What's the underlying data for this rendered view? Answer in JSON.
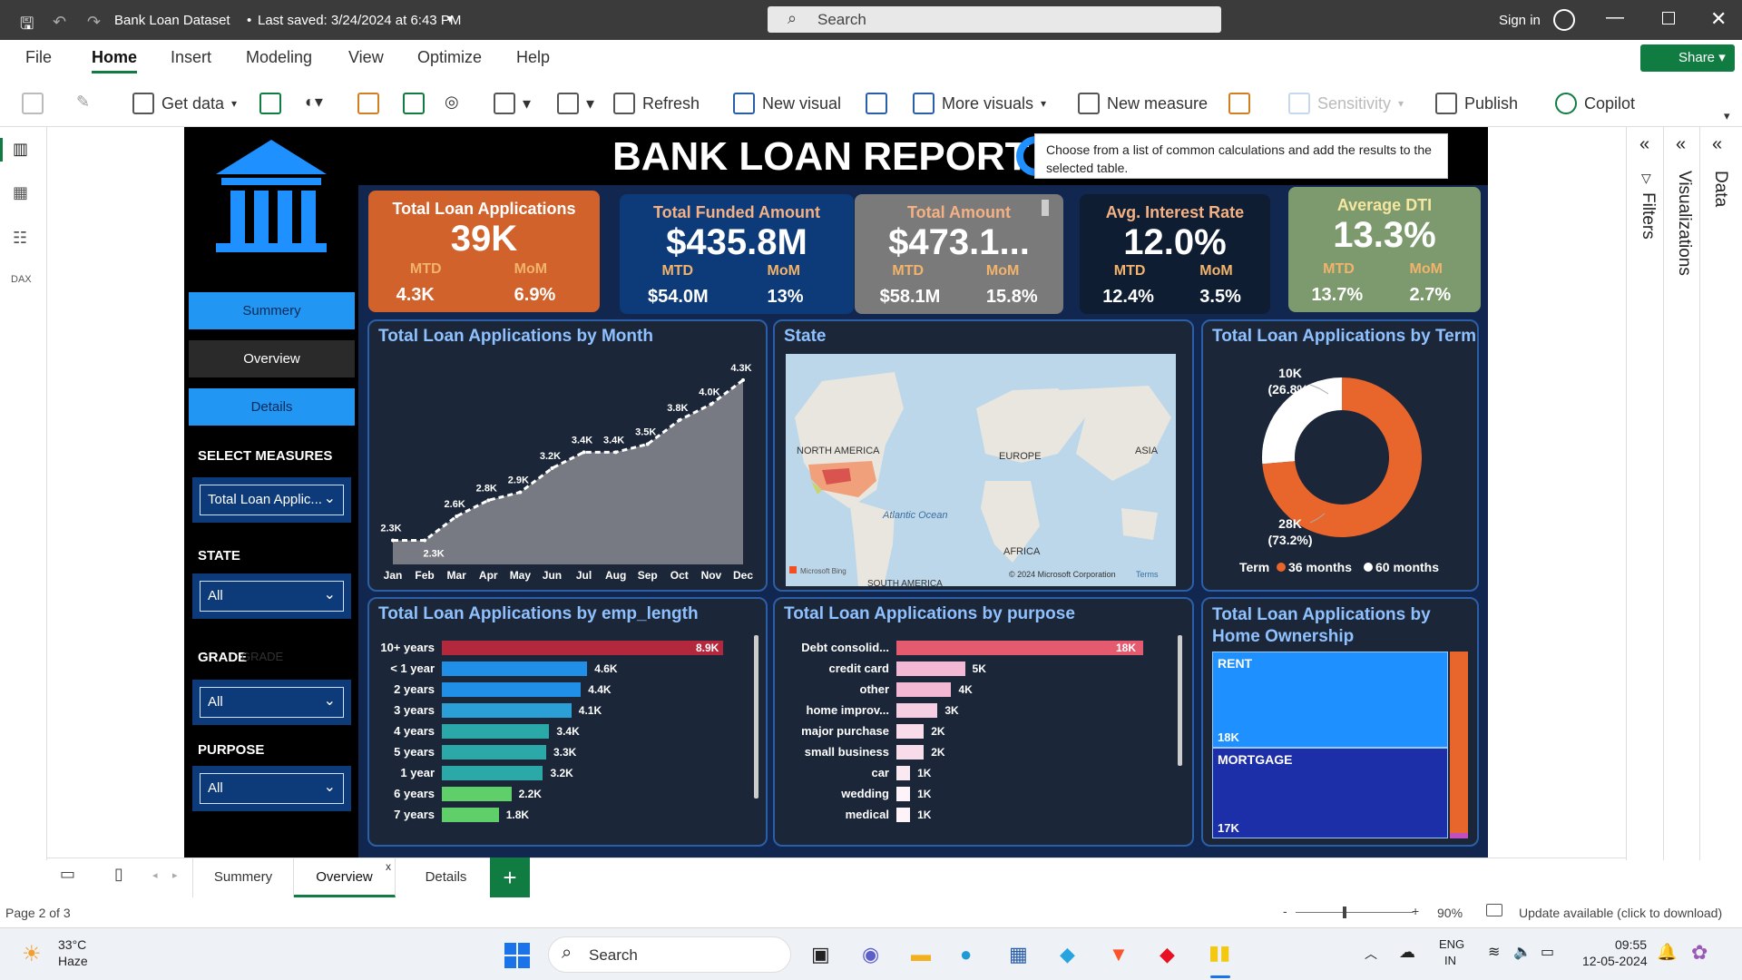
{
  "window": {
    "title": "Bank Loan Dataset",
    "saved": "Last saved: 3/24/2024 at 6:43 PM",
    "search_placeholder": "Search",
    "sign_in": "Sign in"
  },
  "menu": [
    "File",
    "Home",
    "Insert",
    "Modeling",
    "View",
    "Optimize",
    "Help"
  ],
  "share_label": "Share",
  "ribbon": {
    "get_data": "Get data",
    "refresh": "Refresh",
    "new_visual": "New visual",
    "more_visuals": "More visuals",
    "new_measure": "New measure",
    "sensitivity": "Sensitivity",
    "publish": "Publish",
    "copilot": "Copilot"
  },
  "tooltip": "Choose from a list of common calculations and add the results to the selected table.",
  "report": {
    "title": "BANK LOAN REPORT |",
    "nav": {
      "summary": "Summery",
      "overview": "Overview",
      "details": "Details"
    },
    "select_measures": "SELECT MEASURES",
    "measure_value": "Total Loan Applic...",
    "state_label": "STATE",
    "state_value": "All",
    "grade_label": "GRADE",
    "grade_ghost": "GRADE",
    "grade_value": "All",
    "purpose_label": "PURPOSE",
    "purpose_value": "All",
    "kpis": [
      {
        "title": "Total Loan Applications",
        "value": "39K",
        "mtd_label": "MTD",
        "mom_label": "MoM",
        "mtd": "4.3K",
        "mom": "6.9%",
        "color": "#d1622b"
      },
      {
        "title": "Total Funded Amount",
        "value": "$435.8M",
        "mtd_label": "MTD",
        "mom_label": "MoM",
        "mtd": "$54.0M",
        "mom": "13%",
        "color": "#0d3a78"
      },
      {
        "title": "Total Amount",
        "value": "$473.1...",
        "mtd_label": "MTD",
        "mom_label": "MoM",
        "mtd": "$58.1M",
        "mom": "15.8%",
        "color": "#7a7a7a"
      },
      {
        "title": "Avg. Interest Rate",
        "value": "12.0%",
        "mtd_label": "MTD",
        "mom_label": "MoM",
        "mtd": "12.4%",
        "mom": "3.5%",
        "color": "#0f1d33"
      },
      {
        "title": "Average DTI",
        "value": "13.3%",
        "mtd_label": "MTD",
        "mom_label": "MoM",
        "mtd": "13.7%",
        "mom": "2.7%",
        "color": "#7d9a6e"
      }
    ],
    "state_panel": {
      "title": "State",
      "labels": {
        "na": "NORTH AMERICA",
        "europe": "EUROPE",
        "asia": "ASIA",
        "africa": "AFRICA",
        "ocean": "Atlantic Ocean",
        "sa": "SOUTH AMERICA",
        "bing": "Microsoft Bing",
        "copyright": "© 2024 Microsoft Corporation",
        "terms": "Terms"
      }
    },
    "term_panel": {
      "title": "Total Loan Applications by Term",
      "legend_title": "Term",
      "legend": [
        "36 months",
        "60 months"
      ],
      "lbl_a": "10K",
      "lbl_a_pct": "(26.8%)",
      "lbl_b": "28K",
      "lbl_b_pct": "(73.2%)"
    },
    "home_panel": {
      "title": "Total Loan Applications by Home Ownership",
      "rent": "RENT",
      "rent_v": "18K",
      "mortgage": "MORTGAGE",
      "mortgage_v": "17K"
    }
  },
  "chart_data": [
    {
      "type": "area",
      "title": "Total Loan Applications by Month",
      "categories": [
        "Jan",
        "Feb",
        "Mar",
        "Apr",
        "May",
        "Jun",
        "Jul",
        "Aug",
        "Sep",
        "Oct",
        "Nov",
        "Dec"
      ],
      "values": [
        2.3,
        2.3,
        2.6,
        2.8,
        2.9,
        3.2,
        3.4,
        3.4,
        3.5,
        3.8,
        4.0,
        4.3
      ],
      "labels": [
        "2.3K",
        "2.3K",
        "2.6K",
        "2.8K",
        "2.9K",
        "3.2K",
        "3.4K",
        "3.4K",
        "3.5K",
        "3.8K",
        "4.0K",
        "4.3K"
      ]
    },
    {
      "type": "bar",
      "title": "Total Loan Applications by emp_length",
      "categories": [
        "10+ years",
        "< 1 year",
        "2 years",
        "3 years",
        "4 years",
        "5 years",
        "1 year",
        "6 years",
        "7 years"
      ],
      "values": [
        8.9,
        4.6,
        4.4,
        4.1,
        3.4,
        3.3,
        3.2,
        2.2,
        1.8
      ],
      "labels": [
        "8.9K",
        "4.6K",
        "4.4K",
        "4.1K",
        "3.4K",
        "3.3K",
        "3.2K",
        "2.2K",
        "1.8K"
      ],
      "colors": [
        "#b4283e",
        "#1f8fe8",
        "#1f8fe8",
        "#2aa0d6",
        "#2aa9a8",
        "#2aa9a8",
        "#2aa9a8",
        "#5fcf6a",
        "#5fcf6a"
      ]
    },
    {
      "type": "bar",
      "title": "Total Loan Applications by purpose",
      "categories": [
        "Debt consolid...",
        "credit card",
        "other",
        "home improv...",
        "major purchase",
        "small business",
        "car",
        "wedding",
        "medical"
      ],
      "values": [
        18,
        5,
        4,
        3,
        2,
        2,
        1,
        1,
        1
      ],
      "labels": [
        "18K",
        "5K",
        "4K",
        "3K",
        "2K",
        "2K",
        "1K",
        "1K",
        "1K"
      ],
      "colors": [
        "#e45a6f",
        "#f2b8d4",
        "#f2b8d4",
        "#f6cfe3",
        "#f9dcea",
        "#f9dcea",
        "#fbe9f2",
        "#fdf3f8",
        "#fdf3f8"
      ]
    },
    {
      "type": "pie",
      "title": "Total Loan Applications by Term",
      "categories": [
        "36 months",
        "60 months"
      ],
      "values": [
        28,
        10
      ]
    }
  ],
  "tabs": [
    "Summery",
    "Overview",
    "Details"
  ],
  "status": {
    "page": "Page 2 of 3",
    "zoom": "90%",
    "update": "Update available (click to download)"
  },
  "taskbar": {
    "weather_temp": "33°C",
    "weather_desc": "Haze",
    "search": "Search",
    "lang1": "ENG",
    "lang2": "IN",
    "time": "09:55",
    "date": "12-05-2024"
  },
  "right_panes": {
    "filters": "Filters",
    "visualizations": "Visualizations",
    "data": "Data"
  }
}
